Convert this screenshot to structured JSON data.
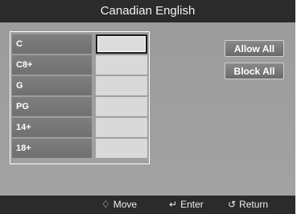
{
  "header": {
    "title": "Canadian English"
  },
  "ratings": {
    "rows": [
      {
        "label": "C",
        "selected": true
      },
      {
        "label": "C8+",
        "selected": false
      },
      {
        "label": "G",
        "selected": false
      },
      {
        "label": "PG",
        "selected": false
      },
      {
        "label": "14+",
        "selected": false
      },
      {
        "label": "18+",
        "selected": false
      }
    ]
  },
  "actions": {
    "allow_all": "Allow All",
    "block_all": "Block All"
  },
  "footer": {
    "move": {
      "icon": "move-arrows-icon",
      "label": "Move"
    },
    "enter": {
      "icon": "enter-icon",
      "label": "Enter"
    },
    "return": {
      "icon": "return-icon",
      "label": "Return"
    }
  },
  "colors": {
    "bar": "#2b2b2b",
    "panel": "#9c9c9c",
    "label_bg": "#777777",
    "cell_bg": "#d9d9d9"
  }
}
